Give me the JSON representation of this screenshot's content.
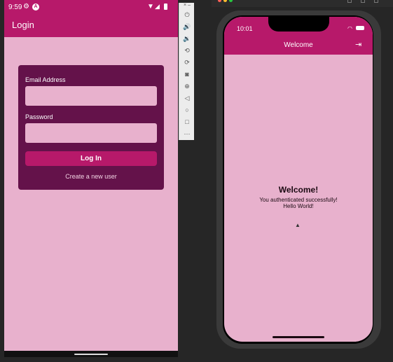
{
  "android": {
    "status": {
      "time": "9:59"
    },
    "appbar": {
      "title": "Login"
    },
    "form": {
      "email_label": "Email Address",
      "email_value": "",
      "password_label": "Password",
      "password_value": "",
      "login_button": "Log In",
      "create_user_link": "Create a new user"
    },
    "colors": {
      "primary": "#b7196a",
      "background": "#e8b1cd",
      "card": "#64124a"
    }
  },
  "ios": {
    "status": {
      "time": "10:01"
    },
    "appbar": {
      "title": "Welcome"
    },
    "content": {
      "heading": "Welcome!",
      "line1": "You authenticated successfully!",
      "line2": "Hello World!"
    }
  }
}
